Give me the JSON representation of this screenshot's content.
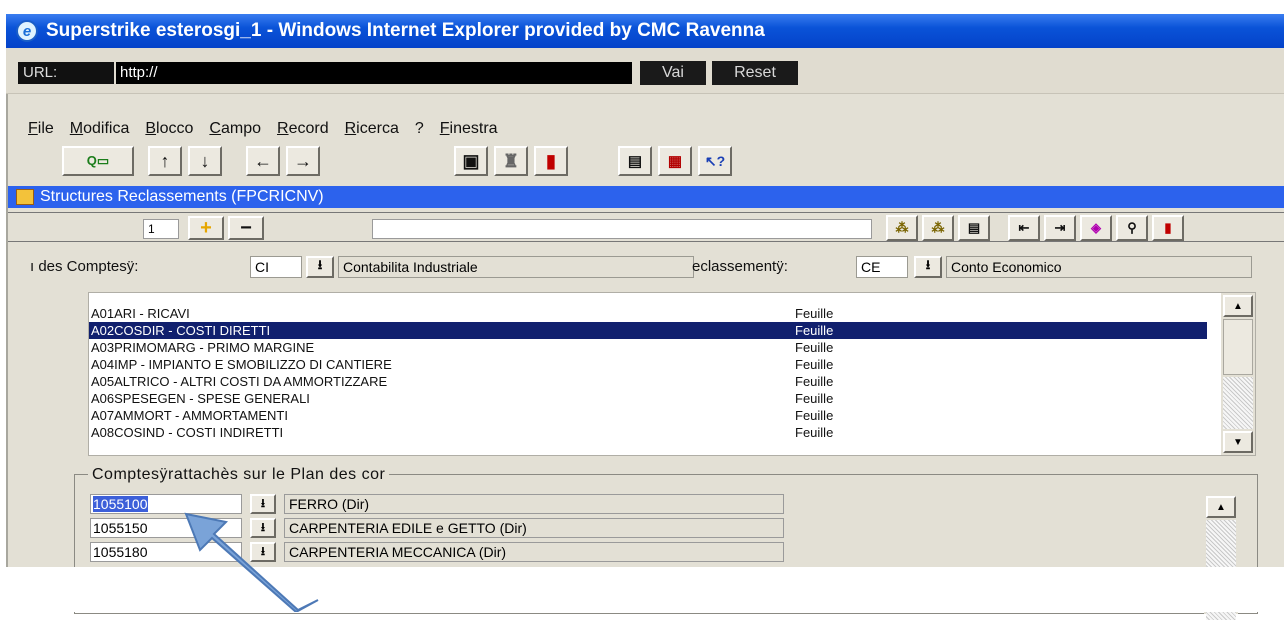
{
  "window": {
    "title": "Superstrike esterosgi_1 - Windows Internet Explorer provided by CMC Ravenna"
  },
  "urlbar": {
    "label": "URL:",
    "value": "http://",
    "go_label": "Vai",
    "reset_label": "Reset"
  },
  "menu": [
    {
      "label": "File",
      "access": "F",
      "rest": "ile"
    },
    {
      "label": "Modifica",
      "access": "M",
      "rest": "odifica"
    },
    {
      "label": "Blocco",
      "access": "B",
      "rest": "locco"
    },
    {
      "label": "Campo",
      "access": "C",
      "rest": "ampo"
    },
    {
      "label": "Record",
      "access": "R",
      "rest": "ecord"
    },
    {
      "label": "Ricerca",
      "access": "R",
      "rest": "icerca"
    },
    {
      "label": "?",
      "access": "",
      "rest": "?"
    },
    {
      "label": "Finestra",
      "access": "F",
      "rest": "inestra"
    }
  ],
  "form": {
    "title": "Structures Reclassements (FPCRICNV)",
    "record_number": "1"
  },
  "selectors": {
    "plan_label": "ı des Comptesÿ:",
    "plan_code": "CI",
    "plan_desc": "Contabilita Industriale",
    "reclass_label": "eclassementÿ:",
    "reclass_code": "CE",
    "reclass_desc": "Conto Economico"
  },
  "structure_list": [
    {
      "code": "A01ARI -  RICAVI",
      "kind": "Feuille",
      "selected": false
    },
    {
      "code": "A02COSDIR - COSTI DIRETTI",
      "kind": "Feuille",
      "selected": true
    },
    {
      "code": "A03PRIMOMARG - PRIMO MARGINE",
      "kind": "Feuille",
      "selected": false
    },
    {
      "code": "A04IMP - IMPIANTO E SMOBILIZZO DI CANTIERE",
      "kind": "Feuille",
      "selected": false
    },
    {
      "code": "A05ALTRICO - ALTRI COSTI DA AMMORTIZZARE",
      "kind": "Feuille",
      "selected": false
    },
    {
      "code": "A06SPESEGEN - SPESE GENERALI",
      "kind": "Feuille",
      "selected": false
    },
    {
      "code": "A07AMMORT - AMMORTAMENTI",
      "kind": "Feuille",
      "selected": false
    },
    {
      "code": "A08COSIND - COSTI INDIRETTI",
      "kind": "Feuille",
      "selected": false
    }
  ],
  "accounts_group": {
    "title": "Comptesÿrattachès sur le Plan des cor",
    "rows": [
      {
        "account": "1055100",
        "desc": "FERRO (Dir)"
      },
      {
        "account": "1055150",
        "desc": "CARPENTERIA EDILE e GETTO (Dir)"
      },
      {
        "account": "1055180",
        "desc": "CARPENTERIA MECCANICA (Dir)"
      }
    ]
  },
  "annotation": {
    "arrow_color": "#7aa3d8"
  }
}
